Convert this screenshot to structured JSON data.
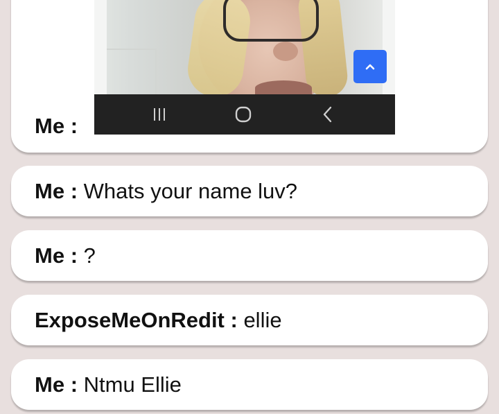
{
  "messages": [
    {
      "sender": "Me",
      "separator": " :",
      "text": ""
    },
    {
      "sender": "Me",
      "separator": " :",
      "text": " Whats your name luv?"
    },
    {
      "sender": "Me",
      "separator": " :",
      "text": " ?"
    },
    {
      "sender": "ExposeMeOnRedit",
      "separator": " :",
      "text": " ellie"
    },
    {
      "sender": "Me",
      "separator": " :",
      "text": " Ntmu Ellie"
    }
  ],
  "attachment": {
    "icons": {
      "scroll_up": "chevron-up-icon",
      "nav_recent": "recent-apps-icon",
      "nav_home": "home-icon",
      "nav_back": "back-icon"
    }
  },
  "colors": {
    "background": "#e8dfde",
    "bubble": "#ffffff",
    "scroll_button": "#2f6df5",
    "navbar": "#222222"
  }
}
